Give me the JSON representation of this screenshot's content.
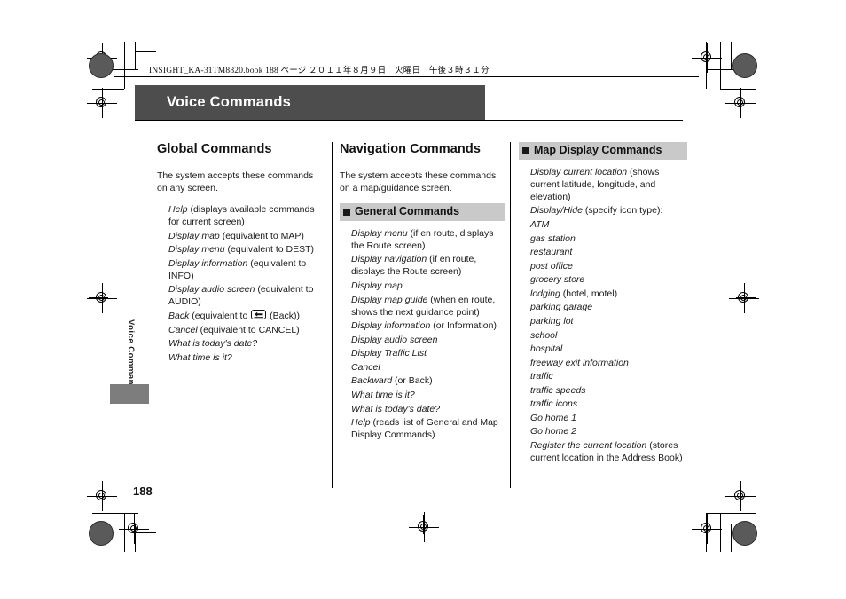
{
  "document": {
    "file_meta": "INSIGHT_KA-31TM8820.book   188 ページ   ２０１１年８月９日　火曜日　午後３時３１分",
    "title": "Voice Commands",
    "side_tab": "Voice Commands",
    "page_number": "188"
  },
  "columns": {
    "global": {
      "title": "Global Commands",
      "intro": "The system accepts these commands on any screen.",
      "items": [
        {
          "cmd": "Help",
          "rest": " (displays available commands for current screen)"
        },
        {
          "cmd": "Display map",
          "rest": " (equivalent to MAP)"
        },
        {
          "cmd": "Display menu",
          "rest": " (equivalent to DEST)"
        },
        {
          "cmd": "Display information",
          "rest": " (equivalent to INFO)"
        },
        {
          "cmd": "Display audio screen",
          "rest": " (equivalent to AUDIO)"
        },
        {
          "cmd": "Back",
          "rest": " (equivalent to ",
          "icon": "back-key-icon",
          "rest2": " (Back))"
        },
        {
          "cmd": "Cancel",
          "rest": " (equivalent to CANCEL)"
        },
        {
          "cmd": "What is today's date?",
          "rest": ""
        },
        {
          "cmd": "What time is it?",
          "rest": ""
        }
      ]
    },
    "navigation": {
      "title": "Navigation Commands",
      "intro": "The system accepts these commands on a map/guidance screen.",
      "subhead": "General Commands",
      "items": [
        {
          "cmd": "Display menu",
          "rest": " (if en route, displays the Route screen)"
        },
        {
          "cmd": "Display navigation",
          "rest": " (if en route, displays the Route screen)"
        },
        {
          "cmd": "Display map",
          "rest": ""
        },
        {
          "cmd": "Display map guide",
          "rest": " (when en route, shows the next guidance point)"
        },
        {
          "cmd": "Display information",
          "rest": " (or Information)"
        },
        {
          "cmd": "Display audio screen",
          "rest": ""
        },
        {
          "cmd": "Display Traffic List",
          "rest": ""
        },
        {
          "cmd": "Cancel",
          "rest": ""
        },
        {
          "cmd": "Backward",
          "rest": " (or Back)"
        },
        {
          "cmd": "What time is it?",
          "rest": ""
        },
        {
          "cmd": "What is today's date?",
          "rest": ""
        },
        {
          "cmd": "Help",
          "rest": " (reads list of General and Map Display Commands)"
        }
      ]
    },
    "map_display": {
      "subhead": "Map Display Commands",
      "items_before": [
        {
          "cmd": "Display current location",
          "rest": " (shows current latitude, longitude, and elevation)"
        },
        {
          "cmd": "Display/Hide",
          "rest": " (specify icon type):"
        }
      ],
      "icon_types": [
        {
          "cmd": "ATM",
          "rest": ""
        },
        {
          "cmd": "gas station",
          "rest": ""
        },
        {
          "cmd": "restaurant",
          "rest": ""
        },
        {
          "cmd": "post office",
          "rest": ""
        },
        {
          "cmd": "grocery store",
          "rest": ""
        },
        {
          "cmd": "lodging",
          "rest": " (hotel, motel)"
        },
        {
          "cmd": "parking garage",
          "rest": ""
        },
        {
          "cmd": "parking lot",
          "rest": ""
        },
        {
          "cmd": "school",
          "rest": ""
        },
        {
          "cmd": "hospital",
          "rest": ""
        },
        {
          "cmd": "freeway exit information",
          "rest": ""
        },
        {
          "cmd": "traffic",
          "rest": ""
        },
        {
          "cmd": "traffic speeds",
          "rest": ""
        },
        {
          "cmd": "traffic icons",
          "rest": ""
        }
      ],
      "items_after": [
        {
          "cmd": "Go home 1",
          "rest": ""
        },
        {
          "cmd": "Go home 2",
          "rest": ""
        },
        {
          "cmd": "Register the current location",
          "rest": " (stores current location in the Address Book)"
        }
      ]
    }
  },
  "colors": {
    "title_bar": "#4d4d4d",
    "subhead_band": "#c9c9c9",
    "side_tab": "#7d7d7d"
  }
}
